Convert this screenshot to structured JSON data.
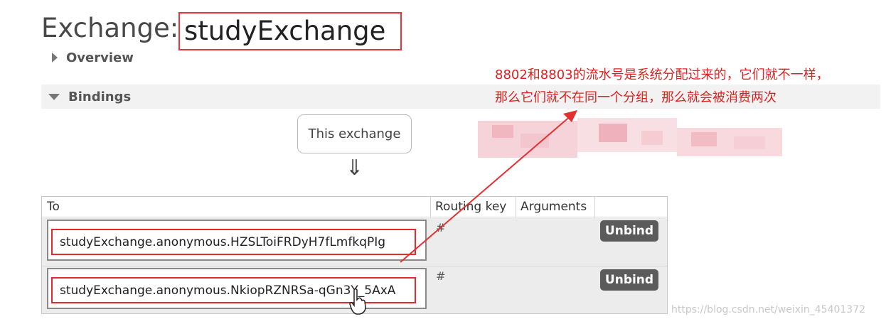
{
  "header": {
    "title_prefix": "Exchange:",
    "exchange_name": "studyExchange"
  },
  "sections": {
    "overview": "Overview",
    "bindings": "Bindings"
  },
  "diagram": {
    "source_label": "This exchange",
    "arrow": "⇓"
  },
  "table": {
    "headers": [
      "To",
      "Routing key",
      "Arguments",
      ""
    ],
    "rows": [
      {
        "to": "studyExchange.anonymous.HZSLToiFRDyH7fLmfkqPIg",
        "routing_key": "#",
        "arguments": "",
        "action": "Unbind"
      },
      {
        "to": "studyExchange.anonymous.NkiopRZNRSa-qGn3Y_5AxA",
        "routing_key": "#",
        "arguments": "",
        "action": "Unbind"
      }
    ]
  },
  "annotation": {
    "line1": "8802和8803的流水号是系统分配过来的，它们就不一样，",
    "line2": "那么它们就不在同一个分组，那么就会被消费两次",
    "color": "#e02020"
  },
  "watermark": "https://blog.csdn.net/weixin_45401372",
  "colors": {
    "highlight_border": "#e32b2b",
    "unbind_button": "#5b5b5b",
    "row_background": "#ececec"
  }
}
